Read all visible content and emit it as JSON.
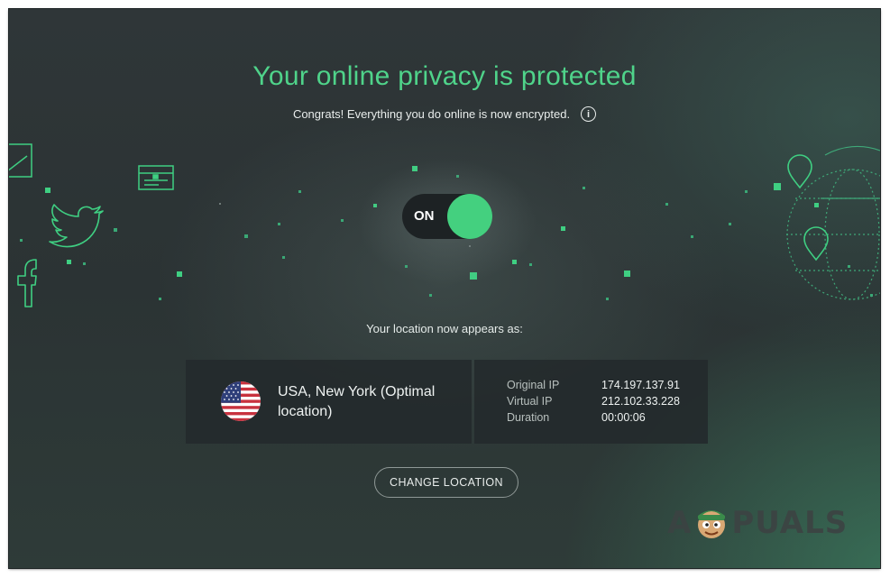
{
  "header": {
    "title": "Your online privacy is protected",
    "subtitle": "Congrats! Everything you do online is now encrypted.",
    "info_icon": "i"
  },
  "toggle": {
    "label": "ON",
    "state": "on",
    "knob_color": "#44d07f"
  },
  "location": {
    "caption": "Your location now appears as:",
    "flag_icon": "us-flag-icon",
    "name": "USA, New York (Optimal location)"
  },
  "connection": {
    "rows": [
      {
        "label": "Original IP",
        "value": "174.197.137.91"
      },
      {
        "label": "Virtual IP",
        "value": "212.102.33.228"
      },
      {
        "label": "Duration",
        "value": "00:00:06"
      }
    ]
  },
  "actions": {
    "change_location": "CHANGE LOCATION"
  },
  "decor_icons": [
    "chart-icon",
    "card-icon",
    "twitter-icon",
    "facebook-icon",
    "location-pin-icon",
    "globe-icon"
  ],
  "watermark": {
    "text_left": "A",
    "text_right": "PUALS"
  },
  "colors": {
    "accent": "#4fd38a",
    "background": "#2e3536",
    "panel": "#242a2c"
  }
}
